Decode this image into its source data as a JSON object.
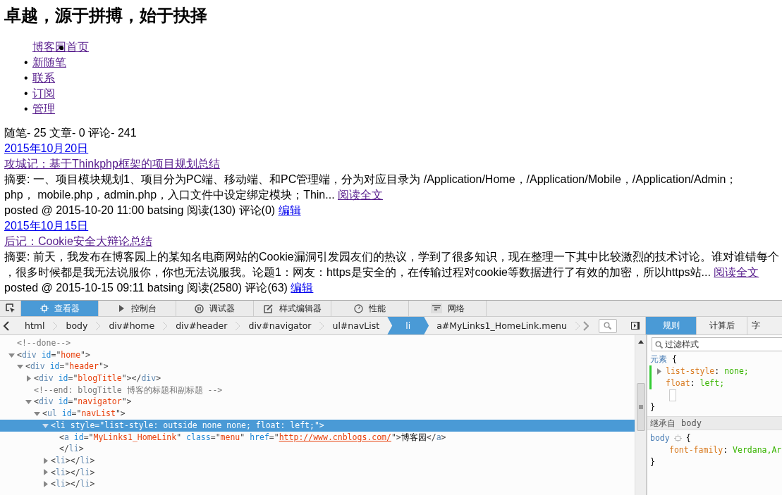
{
  "page": {
    "title": "卓越，源于拼搏，始于抉择",
    "nav": [
      {
        "label": "博客园首页",
        "kind": "floated",
        "visited": true
      },
      {
        "label": "新随笔",
        "kind": "bullet",
        "marker": "•",
        "visited": true
      },
      {
        "label": "联系",
        "kind": "bullet",
        "marker": "•",
        "visited": true
      },
      {
        "label": "订阅",
        "kind": "bullet",
        "marker": "•",
        "visited": true
      },
      {
        "label": "管理",
        "kind": "bullet",
        "marker": "•",
        "visited": true
      }
    ],
    "stats": "随笔- 25  文章- 0  评论- 241",
    "posts": [
      {
        "date": {
          "label": "2015年10月20日",
          "visited": false
        },
        "title": {
          "label": "攻城记：基于Thinkphp框架的项目规划总结",
          "visited": true
        },
        "summary": [
          "摘要: 一、项目模块规划1、项目分为PC端、移动端、和PC管理端，分为对应目录为 /Application/Home，/Application/Mobile，/Application/Admin；",
          "php， mobile.php，admin.php，入口文件中设定绑定模块；Thin... "
        ],
        "read_more": {
          "label": "阅读全文",
          "visited": true
        },
        "footer": "posted @ 2015-10-20 11:00 batsing 阅读(130) 评论(0) ",
        "edit": {
          "label": "编辑",
          "visited": false
        }
      },
      {
        "date": {
          "label": "2015年10月15日",
          "visited": false
        },
        "title": {
          "label": "后记：Cookie安全大辩论总结",
          "visited": true
        },
        "summary": [
          "摘要: 前天，我发布在博客园上的某知名电商网站的Cookie漏洞引发园友们的热议，学到了很多知识，现在整理一下其中比较激烈的技术讨论。谁对谁错每个",
          "，很多时候都是我无法说服你，你也无法说服我。论题1：网友：https是安全的，在传输过程对cookie等数据进行了有效的加密，所以https站... "
        ],
        "read_more": {
          "label": "阅读全文",
          "visited": true
        },
        "footer": "posted @ 2015-10-15 09:11 batsing 阅读(2580) 评论(63) ",
        "edit": {
          "label": "编辑",
          "visited": false
        }
      }
    ]
  },
  "devtools": {
    "tabs": [
      {
        "label": "查看器",
        "kind": "inspector",
        "selected": true
      },
      {
        "label": "控制台",
        "kind": "console",
        "selected": false
      },
      {
        "label": "调试器",
        "kind": "debugger",
        "selected": false
      },
      {
        "label": "样式编辑器",
        "kind": "style",
        "selected": false
      },
      {
        "label": "性能",
        "kind": "performance",
        "selected": false
      },
      {
        "label": "网络",
        "kind": "network",
        "selected": false
      }
    ],
    "breadcrumbs": [
      {
        "label": "html",
        "selected": false
      },
      {
        "label": "body",
        "selected": false
      },
      {
        "label": "div#home",
        "selected": false
      },
      {
        "label": "div#header",
        "selected": false
      },
      {
        "label": "div#navigator",
        "selected": false
      },
      {
        "label": "ul#navList",
        "selected": false
      },
      {
        "label": "li",
        "selected": true
      },
      {
        "label": "a#MyLinks1_HomeLink.menu",
        "selected": false
      }
    ],
    "markup": [
      {
        "segments": [
          {
            "text": "<!--done-->",
            "kind": "c"
          }
        ],
        "selected": false
      },
      {
        "segments": [
          {
            "text": "<",
            "kind": "p"
          },
          {
            "text": "div",
            "kind": "t"
          },
          {
            "text": " id",
            "kind": "a"
          },
          {
            "text": "=\"",
            "kind": "p"
          },
          {
            "text": "home",
            "kind": "v"
          },
          {
            "text": "\">",
            "kind": "p"
          }
        ],
        "expanded": true,
        "selected": false,
        "children": [
          {
            "segments": [
              {
                "text": "<",
                "kind": "p"
              },
              {
                "text": "div",
                "kind": "t"
              },
              {
                "text": " id",
                "kind": "a"
              },
              {
                "text": "=\"",
                "kind": "p"
              },
              {
                "text": "header",
                "kind": "v"
              },
              {
                "text": "\">",
                "kind": "p"
              }
            ],
            "expanded": true,
            "selected": false,
            "children": [
              {
                "segments": [
                  {
                    "text": "<",
                    "kind": "p"
                  },
                  {
                    "text": "div",
                    "kind": "t"
                  },
                  {
                    "text": " id",
                    "kind": "a"
                  },
                  {
                    "text": "=\"",
                    "kind": "p"
                  },
                  {
                    "text": "blogTitle",
                    "kind": "v"
                  },
                  {
                    "text": "\"></",
                    "kind": "p"
                  },
                  {
                    "text": "div",
                    "kind": "t"
                  },
                  {
                    "text": ">",
                    "kind": "p"
                  }
                ],
                "expanded": false,
                "selected": false
              },
              {
                "segments": [
                  {
                    "text": "<!--end: blogTitle 博客的标题和副标题 -->",
                    "kind": "c"
                  }
                ],
                "selected": false
              },
              {
                "segments": [
                  {
                    "text": "<",
                    "kind": "p"
                  },
                  {
                    "text": "div",
                    "kind": "t"
                  },
                  {
                    "text": " id",
                    "kind": "a"
                  },
                  {
                    "text": "=\"",
                    "kind": "p"
                  },
                  {
                    "text": "navigator",
                    "kind": "v"
                  },
                  {
                    "text": "\">",
                    "kind": "p"
                  }
                ],
                "expanded": true,
                "selected": false,
                "children": [
                  {
                    "segments": [
                      {
                        "text": "<",
                        "kind": "p"
                      },
                      {
                        "text": "ul",
                        "kind": "t"
                      },
                      {
                        "text": " id",
                        "kind": "a"
                      },
                      {
                        "text": "=\"",
                        "kind": "p"
                      },
                      {
                        "text": "navList",
                        "kind": "v"
                      },
                      {
                        "text": "\">",
                        "kind": "p"
                      }
                    ],
                    "expanded": true,
                    "selected": false,
                    "children": [
                      {
                        "segments": [
                          {
                            "text": "<",
                            "kind": "p"
                          },
                          {
                            "text": "li",
                            "kind": "t"
                          },
                          {
                            "text": " style",
                            "kind": "a"
                          },
                          {
                            "text": "=\"",
                            "kind": "p"
                          },
                          {
                            "text": "list-style: outside none none; float: left;",
                            "kind": "v"
                          },
                          {
                            "text": "\">",
                            "kind": "p"
                          }
                        ],
                        "expanded": true,
                        "selected": true,
                        "children": [
                          {
                            "segments": [
                              {
                                "text": "<",
                                "kind": "p"
                              },
                              {
                                "text": "a",
                                "kind": "t"
                              },
                              {
                                "text": " id",
                                "kind": "a"
                              },
                              {
                                "text": "=\"",
                                "kind": "p"
                              },
                              {
                                "text": "MyLinks1_HomeLink",
                                "kind": "v"
                              },
                              {
                                "text": "\"",
                                "kind": "p"
                              },
                              {
                                "text": " class",
                                "kind": "a"
                              },
                              {
                                "text": "=\"",
                                "kind": "p"
                              },
                              {
                                "text": "menu",
                                "kind": "v"
                              },
                              {
                                "text": "\"",
                                "kind": "p"
                              },
                              {
                                "text": " href",
                                "kind": "a"
                              },
                              {
                                "text": "=\"",
                                "kind": "p"
                              },
                              {
                                "text": "http://www.cnblogs.com/",
                                "kind": "l"
                              },
                              {
                                "text": "\">",
                                "kind": "p"
                              },
                              {
                                "text": "博客园",
                                "kind": "x"
                              },
                              {
                                "text": "</",
                                "kind": "p"
                              },
                              {
                                "text": "a",
                                "kind": "t"
                              },
                              {
                                "text": ">",
                                "kind": "p"
                              }
                            ],
                            "selected": false
                          },
                          {
                            "segments": [
                              {
                                "text": "</",
                                "kind": "p"
                              },
                              {
                                "text": "li",
                                "kind": "t"
                              },
                              {
                                "text": ">",
                                "kind": "p"
                              }
                            ],
                            "selected": false
                          }
                        ]
                      },
                      {
                        "segments": [
                          {
                            "text": "<",
                            "kind": "p"
                          },
                          {
                            "text": "li",
                            "kind": "t"
                          },
                          {
                            "text": "></",
                            "kind": "p"
                          },
                          {
                            "text": "li",
                            "kind": "t"
                          },
                          {
                            "text": ">",
                            "kind": "p"
                          }
                        ],
                        "expanded": false,
                        "selected": false
                      },
                      {
                        "segments": [
                          {
                            "text": "<",
                            "kind": "p"
                          },
                          {
                            "text": "li",
                            "kind": "t"
                          },
                          {
                            "text": "></",
                            "kind": "p"
                          },
                          {
                            "text": "li",
                            "kind": "t"
                          },
                          {
                            "text": ">",
                            "kind": "p"
                          }
                        ],
                        "expanded": false,
                        "selected": false
                      },
                      {
                        "segments": [
                          {
                            "text": "<",
                            "kind": "p"
                          },
                          {
                            "text": "li",
                            "kind": "t"
                          },
                          {
                            "text": "></",
                            "kind": "p"
                          },
                          {
                            "text": "li",
                            "kind": "t"
                          },
                          {
                            "text": ">",
                            "kind": "p"
                          }
                        ],
                        "expanded": false,
                        "selected": false
                      }
                    ]
                  }
                ]
              }
            ]
          }
        ]
      }
    ],
    "sidebar_tabs": [
      {
        "label": "规则",
        "selected": true
      },
      {
        "label": "计算后",
        "selected": false
      },
      {
        "label": "字",
        "selected": false
      }
    ],
    "filter": {
      "placeholder": "过滤样式"
    },
    "rules": {
      "selector": "元素",
      "open_brace": "{",
      "declarations": [
        {
          "property": "list-style",
          "separator": ":",
          "value": "none;",
          "expandable": true
        },
        {
          "property": "float",
          "separator": ":",
          "value": "left;",
          "expandable": false
        }
      ],
      "close_brace": "}"
    },
    "inherited": {
      "label": "继承自",
      "source": "body"
    },
    "inherited_rule": {
      "selector": "body",
      "open_brace": "{",
      "declarations": [
        {
          "property": "font-family",
          "separator": ":",
          "value": "Verdana,Ar"
        }
      ],
      "close_brace": "}"
    }
  }
}
